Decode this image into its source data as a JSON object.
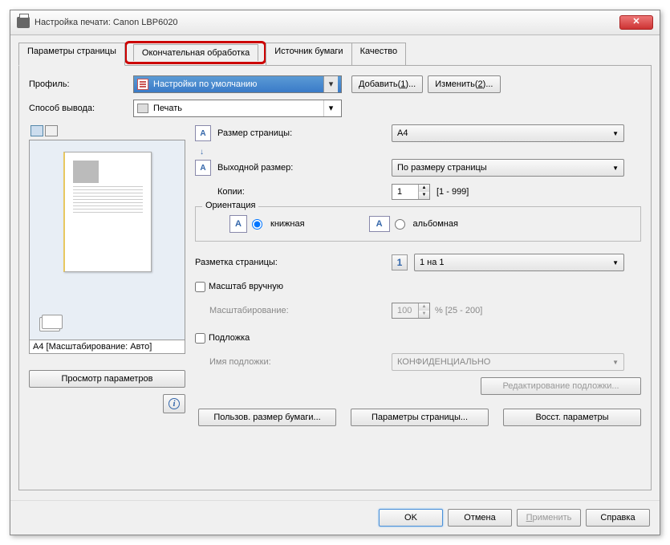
{
  "window": {
    "title": "Настройка печати: Canon LBP6020"
  },
  "tabs": {
    "page_params": "Параметры страницы",
    "finishing": "Окончательная обработка",
    "paper_source": "Источник бумаги",
    "quality": "Качество"
  },
  "profile": {
    "label": "Профиль:",
    "value": "Настройки по умолчанию",
    "add_btn": "Добавить(1)...",
    "edit_btn": "Изменить(2)..."
  },
  "output": {
    "label": "Способ вывода:",
    "value": "Печать"
  },
  "preview": {
    "caption": "A4 [Масштабирование: Авто]",
    "view_params_btn": "Просмотр параметров"
  },
  "settings": {
    "page_size": {
      "label": "Размер страницы:",
      "value": "A4"
    },
    "output_size": {
      "label": "Выходной размер:",
      "value": "По размеру страницы"
    },
    "copies": {
      "label": "Копии:",
      "value": "1",
      "range": "[1 - 999]"
    },
    "orientation": {
      "legend": "Ориентация",
      "portrait": "книжная",
      "landscape": "альбомная"
    },
    "layout": {
      "label": "Разметка страницы:",
      "value": "1 на 1",
      "icon_num": "1"
    },
    "manual_scale": {
      "checkbox": "Масштаб вручную",
      "label": "Масштабирование:",
      "value": "100",
      "range": "% [25 - 200]"
    },
    "watermark": {
      "checkbox": "Подложка",
      "name_label": "Имя подложки:",
      "value": "КОНФИДЕНЦИАЛЬНО",
      "edit_btn": "Редактирование подложки..."
    }
  },
  "bottom": {
    "custom_size": "Пользов. размер бумаги...",
    "page_params": "Параметры страницы...",
    "restore": "Восст. параметры"
  },
  "footer": {
    "ok": "OK",
    "cancel": "Отмена",
    "apply": "Применить",
    "help": "Справка"
  }
}
